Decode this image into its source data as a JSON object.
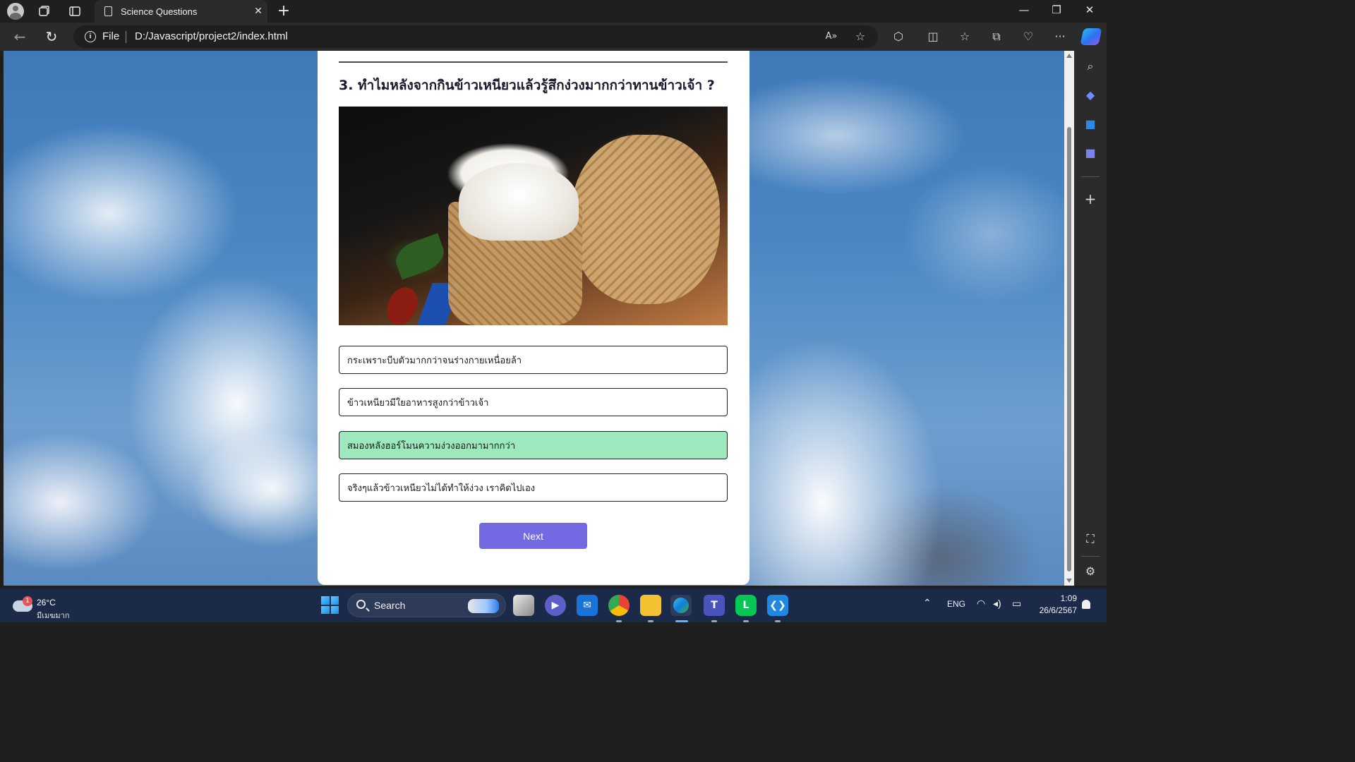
{
  "browser": {
    "tab_title": "Science Questions",
    "file_label": "File",
    "url": "D:/Javascript/project2/index.html"
  },
  "quiz": {
    "question": "3. ทำไมหลังจากกินข้าวเหนียวแล้วรู้สึกง่วงมากกว่าทานข้าวเจ้า ?",
    "answers": [
      {
        "text": "กระเพราะบีบตัวมากกว่าจนร่างกายเหนื่อยล้า",
        "state": "default"
      },
      {
        "text": "ข้าวเหนียวมีใยอาหารสูงกว่าข้าวเจ้า",
        "state": "default"
      },
      {
        "text": "สมองหลังฮอร์โมนความง่วงออกมามากกว่า",
        "state": "correct"
      },
      {
        "text": "จริงๆแล้วข้าวเหนียวไม่ได้ทำให้ง่วง เราคิดไปเอง",
        "state": "default"
      }
    ],
    "next_label": "Next",
    "correct_color": "#9de8bd",
    "button_color": "#7269e3"
  },
  "taskbar": {
    "weather_temp": "26°C",
    "weather_condition": "มีเมฆมาก",
    "weather_badge": "1",
    "search_label": "Search",
    "language": "ENG",
    "time": "1:09",
    "date": "26/6/2567",
    "apps": [
      "explorer-icon",
      "chat-icon",
      "mail-icon",
      "chrome-icon",
      "file-explorer-icon",
      "edge-icon",
      "teams-icon",
      "line-icon",
      "vscode-icon"
    ]
  }
}
